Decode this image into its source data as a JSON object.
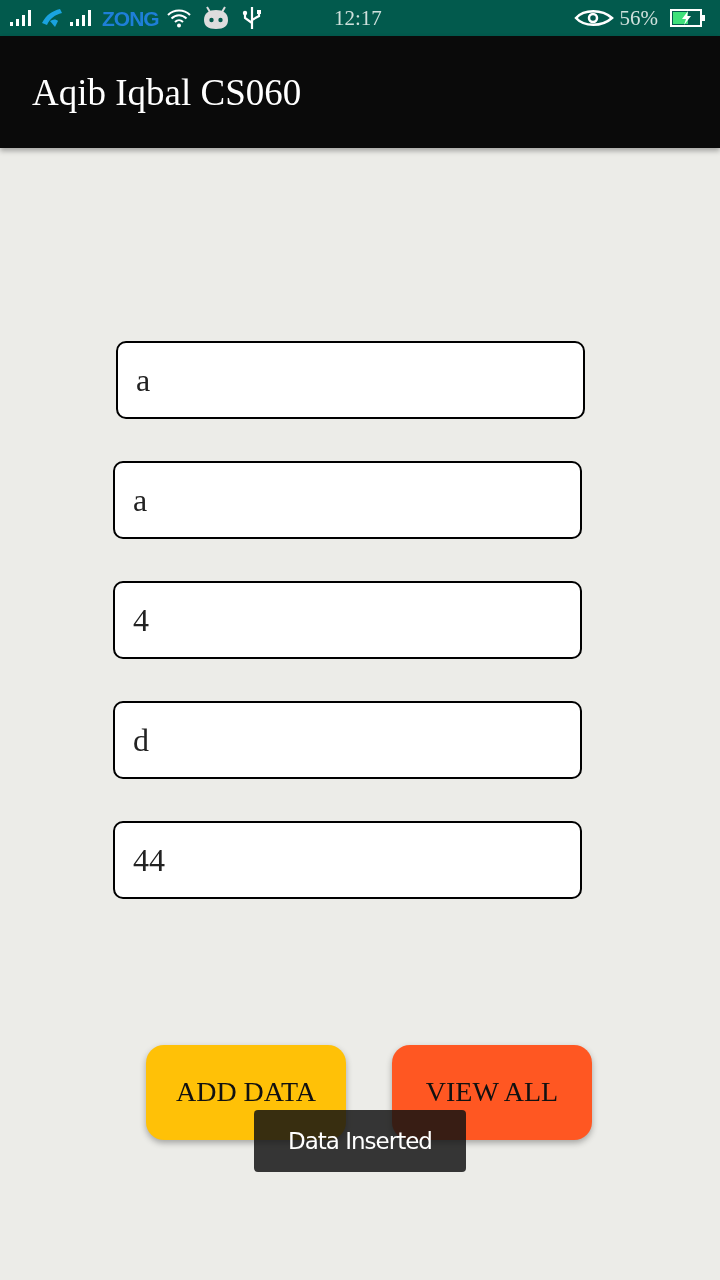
{
  "status_bar": {
    "carrier_logo": "ZONG",
    "time": "12:17",
    "battery_percent": "56%",
    "charging": true
  },
  "app_bar": {
    "title": "Aqib Iqbal CS060"
  },
  "fields": [
    {
      "value": "a"
    },
    {
      "value": "a"
    },
    {
      "value": "4"
    },
    {
      "value": "d"
    },
    {
      "value": "44"
    }
  ],
  "buttons": [
    {
      "label": "ADD DATA",
      "color": "#ffc107"
    },
    {
      "label": "VIEW ALL",
      "color": "#ff5722"
    }
  ],
  "toast": {
    "message": "Data Inserted"
  }
}
